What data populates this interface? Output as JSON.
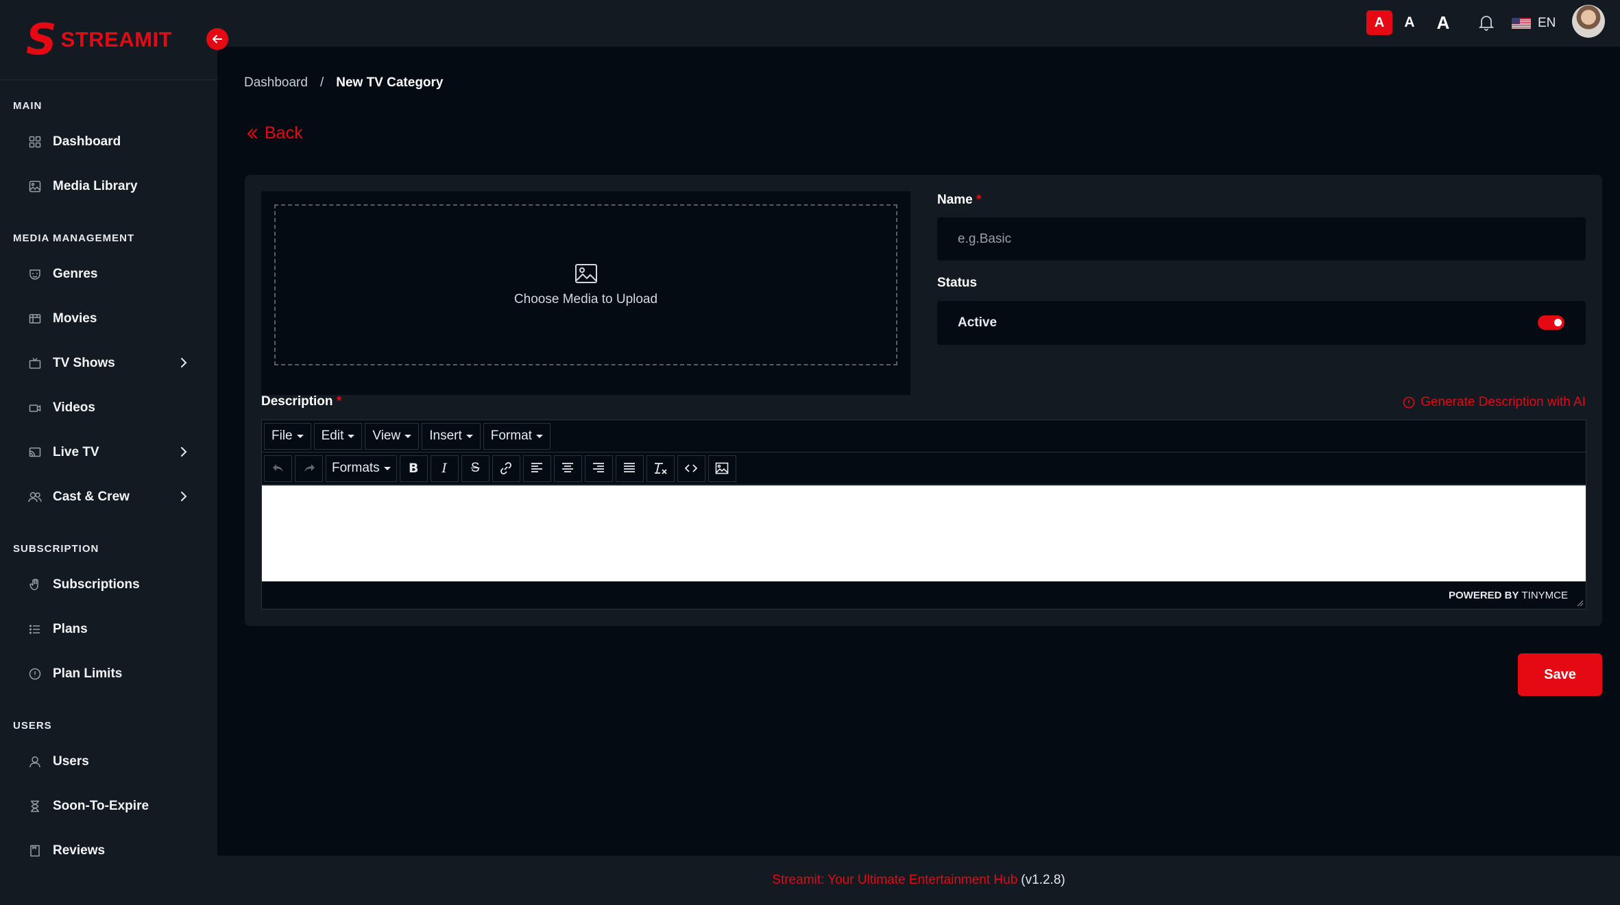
{
  "brand": {
    "name": "STREAMIT",
    "accent_color": "#e50914"
  },
  "sidebar": {
    "sections": [
      {
        "title": "MAIN",
        "items": [
          {
            "label": "Dashboard",
            "icon": "grid-icon"
          },
          {
            "label": "Media Library",
            "icon": "image-icon"
          }
        ]
      },
      {
        "title": "MEDIA MANAGEMENT",
        "items": [
          {
            "label": "Genres",
            "icon": "mask-icon"
          },
          {
            "label": "Movies",
            "icon": "film-icon"
          },
          {
            "label": "TV Shows",
            "icon": "tv-icon",
            "has_children": true
          },
          {
            "label": "Videos",
            "icon": "video-camera-icon"
          },
          {
            "label": "Live TV",
            "icon": "cast-icon",
            "has_children": true
          },
          {
            "label": "Cast & Crew",
            "icon": "people-icon",
            "has_children": true
          }
        ]
      },
      {
        "title": "SUBSCRIPTION",
        "items": [
          {
            "label": "Subscriptions",
            "icon": "hand-icon"
          },
          {
            "label": "Plans",
            "icon": "list-icon"
          },
          {
            "label": "Plan Limits",
            "icon": "info-circle-icon"
          }
        ]
      },
      {
        "title": "USERS",
        "items": [
          {
            "label": "Users",
            "icon": "user-icon"
          },
          {
            "label": "Soon-To-Expire",
            "icon": "hourglass-icon"
          },
          {
            "label": "Reviews",
            "icon": "review-icon"
          }
        ]
      }
    ]
  },
  "topbar": {
    "font_sizes": [
      "A",
      "A",
      "A"
    ],
    "language": "EN"
  },
  "breadcrumb": {
    "home": "Dashboard",
    "separator": "/",
    "current": "New TV Category"
  },
  "back_label": "Back",
  "form": {
    "upload_text": "Choose Media to Upload",
    "name_label": "Name",
    "name_placeholder": "e.g.Basic",
    "name_value": "",
    "required_mark": "*",
    "status_label": "Status",
    "status_value": "Active",
    "status_on": true,
    "description_label": "Description",
    "generate_ai_label": "Generate Description with AI",
    "save_label": "Save"
  },
  "editor": {
    "menus": [
      "File",
      "Edit",
      "View",
      "Insert",
      "Format"
    ],
    "formats_label": "Formats",
    "powered_by": "POWERED BY",
    "powered_brand": "TINYMCE"
  },
  "footer": {
    "brand_text": "Streamit: Your Ultimate Entertainment Hub",
    "version": "(v1.2.8)"
  }
}
